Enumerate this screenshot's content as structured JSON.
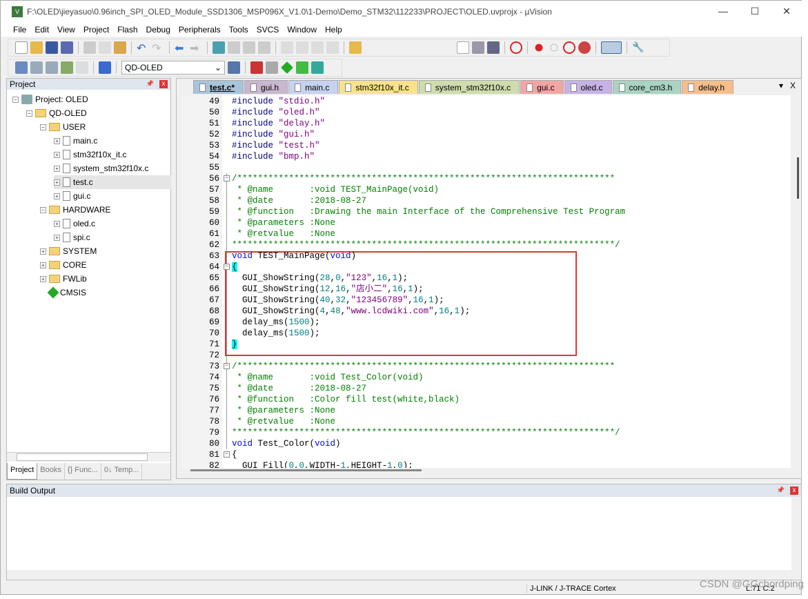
{
  "window": {
    "title": "F:\\OLED\\jieyasuo\\0.96inch_SPI_OLED_Module_SSD1306_MSP096X_V1.0\\1-Demo\\Demo_STM32\\112233\\PROJECT\\OLED.uvprojx - µVision",
    "minimize": "—",
    "maximize": "☐",
    "close": "✕"
  },
  "menu": [
    "File",
    "Edit",
    "View",
    "Project",
    "Flash",
    "Debug",
    "Peripherals",
    "Tools",
    "SVCS",
    "Window",
    "Help"
  ],
  "toolbar": {
    "target": "QD-OLED"
  },
  "project": {
    "title": "Project",
    "pin": "📌",
    "close": "x",
    "tree": [
      {
        "label": "Project: OLED",
        "level": 0,
        "type": "proj",
        "pm": "−"
      },
      {
        "label": "QD-OLED",
        "level": 1,
        "type": "folder",
        "pm": "−"
      },
      {
        "label": "USER",
        "level": 2,
        "type": "folder",
        "pm": "−"
      },
      {
        "label": "main.c",
        "level": 3,
        "type": "file",
        "pm": "+"
      },
      {
        "label": "stm32f10x_it.c",
        "level": 3,
        "type": "file",
        "pm": "+"
      },
      {
        "label": "system_stm32f10x.c",
        "level": 3,
        "type": "file",
        "pm": "+"
      },
      {
        "label": "test.c",
        "level": 3,
        "type": "file",
        "pm": "+",
        "selected": true
      },
      {
        "label": "gui.c",
        "level": 3,
        "type": "file",
        "pm": "+"
      },
      {
        "label": "HARDWARE",
        "level": 2,
        "type": "folder",
        "pm": "−"
      },
      {
        "label": "oled.c",
        "level": 3,
        "type": "file",
        "pm": "+"
      },
      {
        "label": "spi.c",
        "level": 3,
        "type": "file",
        "pm": "+"
      },
      {
        "label": "SYSTEM",
        "level": 2,
        "type": "folder",
        "pm": "+"
      },
      {
        "label": "CORE",
        "level": 2,
        "type": "folder",
        "pm": "+"
      },
      {
        "label": "FWLib",
        "level": 2,
        "type": "folder",
        "pm": "+"
      },
      {
        "label": "CMSIS",
        "level": 2,
        "type": "cmsis",
        "pm": ""
      }
    ],
    "tabs": [
      "Project",
      "Books",
      "{} Func...",
      "0↓ Temp..."
    ]
  },
  "editor": {
    "tabs": [
      {
        "label": "test.c*",
        "color": "#a9c4d9"
      },
      {
        "label": "gui.h",
        "color": "#c9b6cf"
      },
      {
        "label": "main.c",
        "color": "#c6d2ef"
      },
      {
        "label": "stm32f10x_it.c",
        "color": "#f9e28d"
      },
      {
        "label": "system_stm32f10x.c",
        "color": "#cfdcae"
      },
      {
        "label": "gui.c",
        "color": "#f2a5a5"
      },
      {
        "label": "oled.c",
        "color": "#c7b2e5"
      },
      {
        "label": "core_cm3.h",
        "color": "#a9d3c3"
      },
      {
        "label": "delay.h",
        "color": "#f8bd8d"
      }
    ],
    "tabs_menu": "▾",
    "tabs_close": "X",
    "lines": [
      {
        "n": "49",
        "t": [
          [
            "#include ",
            "pp"
          ],
          [
            "\"stdio.h\"",
            "str"
          ]
        ]
      },
      {
        "n": "50",
        "t": [
          [
            "#include ",
            "pp"
          ],
          [
            "\"oled.h\"",
            "str"
          ]
        ]
      },
      {
        "n": "51",
        "t": [
          [
            "#include ",
            "pp"
          ],
          [
            "\"delay.h\"",
            "str"
          ]
        ]
      },
      {
        "n": "52",
        "t": [
          [
            "#include ",
            "pp"
          ],
          [
            "\"gui.h\"",
            "str"
          ]
        ]
      },
      {
        "n": "53",
        "t": [
          [
            "#include ",
            "pp"
          ],
          [
            "\"test.h\"",
            "str"
          ]
        ]
      },
      {
        "n": "54",
        "t": [
          [
            "#include ",
            "pp"
          ],
          [
            "\"bmp.h\"",
            "str"
          ]
        ]
      },
      {
        "n": "55",
        "t": []
      },
      {
        "n": "56",
        "fold": "−",
        "t": [
          [
            "/*************************************************************************",
            "cm"
          ]
        ]
      },
      {
        "n": "57",
        "t": [
          [
            " * @name       :void TEST_MainPage(void)",
            "cm"
          ]
        ]
      },
      {
        "n": "58",
        "t": [
          [
            " * @date       :2018-08-27",
            "cm"
          ]
        ]
      },
      {
        "n": "59",
        "t": [
          [
            " * @function   :Drawing the main Interface of the Comprehensive Test Program",
            "cm"
          ]
        ]
      },
      {
        "n": "60",
        "t": [
          [
            " * @parameters :None",
            "cm"
          ]
        ]
      },
      {
        "n": "61",
        "t": [
          [
            " * @retvalue   :None",
            "cm"
          ]
        ]
      },
      {
        "n": "62",
        "t": [
          [
            "**************************************************************************/",
            "cm"
          ]
        ]
      },
      {
        "n": "63",
        "t": [
          [
            "void",
            "kw"
          ],
          [
            " TEST_MainPage(",
            ""
          ],
          [
            "void",
            "kw"
          ],
          [
            ")",
            ""
          ]
        ]
      },
      {
        "n": "64",
        "fold": "−",
        "t": [
          [
            "{",
            "br"
          ]
        ]
      },
      {
        "n": "65",
        "t": [
          [
            "  GUI_ShowString(",
            ""
          ],
          [
            "28",
            "num"
          ],
          [
            ",",
            ""
          ],
          [
            "0",
            "num"
          ],
          [
            ",",
            ""
          ],
          [
            "\"123\"",
            "str"
          ],
          [
            ",",
            ""
          ],
          [
            "16",
            "num"
          ],
          [
            ",",
            ""
          ],
          [
            "1",
            "num"
          ],
          [
            ");",
            ""
          ]
        ]
      },
      {
        "n": "66",
        "t": [
          [
            "  GUI_ShowString(",
            ""
          ],
          [
            "12",
            "num"
          ],
          [
            ",",
            ""
          ],
          [
            "16",
            "num"
          ],
          [
            ",",
            ""
          ],
          [
            "\"店小二\"",
            "str"
          ],
          [
            ",",
            ""
          ],
          [
            "16",
            "num"
          ],
          [
            ",",
            ""
          ],
          [
            "1",
            "num"
          ],
          [
            ");",
            ""
          ]
        ]
      },
      {
        "n": "67",
        "t": [
          [
            "  GUI_ShowString(",
            ""
          ],
          [
            "40",
            "num"
          ],
          [
            ",",
            ""
          ],
          [
            "32",
            "num"
          ],
          [
            ",",
            ""
          ],
          [
            "\"123456789\"",
            "str"
          ],
          [
            ",",
            ""
          ],
          [
            "16",
            "num"
          ],
          [
            ",",
            ""
          ],
          [
            "1",
            "num"
          ],
          [
            ");",
            ""
          ]
        ]
      },
      {
        "n": "68",
        "t": [
          [
            "  GUI_ShowString(",
            ""
          ],
          [
            "4",
            "num"
          ],
          [
            ",",
            ""
          ],
          [
            "48",
            "num"
          ],
          [
            ",",
            ""
          ],
          [
            "\"www.lcdwiki.com\"",
            "str"
          ],
          [
            ",",
            ""
          ],
          [
            "16",
            "num"
          ],
          [
            ",",
            ""
          ],
          [
            "1",
            "num"
          ],
          [
            ");",
            ""
          ]
        ]
      },
      {
        "n": "69",
        "t": [
          [
            "  delay_ms(",
            ""
          ],
          [
            "1500",
            "num"
          ],
          [
            ");",
            ""
          ]
        ]
      },
      {
        "n": "70",
        "t": [
          [
            "  delay_ms(",
            ""
          ],
          [
            "1500",
            "num"
          ],
          [
            ");",
            ""
          ]
        ]
      },
      {
        "n": "71",
        "t": [
          [
            "}",
            "br"
          ]
        ]
      },
      {
        "n": "72",
        "t": []
      },
      {
        "n": "73",
        "fold": "−",
        "t": [
          [
            "/*************************************************************************",
            "cm"
          ]
        ]
      },
      {
        "n": "74",
        "t": [
          [
            " * @name       :void Test_Color(void)",
            "cm"
          ]
        ]
      },
      {
        "n": "75",
        "t": [
          [
            " * @date       :2018-08-27",
            "cm"
          ]
        ]
      },
      {
        "n": "76",
        "t": [
          [
            " * @function   :Color fill test(white,black)",
            "cm"
          ]
        ]
      },
      {
        "n": "77",
        "t": [
          [
            " * @parameters :None",
            "cm"
          ]
        ]
      },
      {
        "n": "78",
        "t": [
          [
            " * @retvalue   :None",
            "cm"
          ]
        ]
      },
      {
        "n": "79",
        "t": [
          [
            "**************************************************************************/",
            "cm"
          ]
        ]
      },
      {
        "n": "80",
        "t": [
          [
            "void",
            "kw"
          ],
          [
            " Test_Color(",
            ""
          ],
          [
            "void",
            "kw"
          ],
          [
            ")",
            ""
          ]
        ]
      },
      {
        "n": "81",
        "fold": "−",
        "t": [
          [
            "{",
            ""
          ]
        ]
      },
      {
        "n": "82",
        "t": [
          [
            "  GUI_Fill(",
            ""
          ],
          [
            "0",
            "num"
          ],
          [
            ",",
            ""
          ],
          [
            "0",
            "num"
          ],
          [
            ",WIDTH-",
            ""
          ],
          [
            "1",
            "num"
          ],
          [
            ",HEIGHT-",
            ""
          ],
          [
            "1",
            "num"
          ],
          [
            ",",
            ""
          ],
          [
            "0",
            "num"
          ],
          [
            ");",
            ""
          ]
        ]
      }
    ]
  },
  "build": {
    "title": "Build Output",
    "pin": "📌",
    "close": "x"
  },
  "status": {
    "debugger": "J-LINK / J-TRACE Cortex",
    "position": "L:71 C:2"
  },
  "watermark": "CSDN @GGchordping"
}
